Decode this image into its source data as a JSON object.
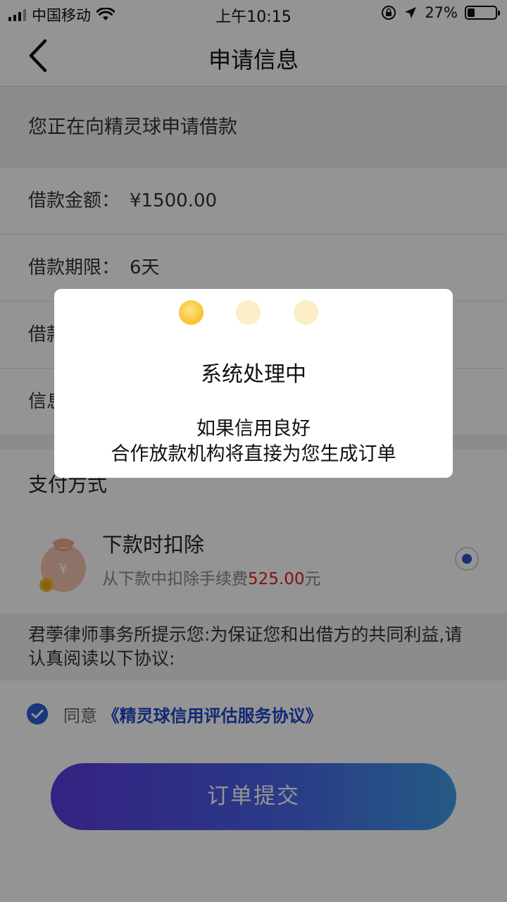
{
  "status_bar": {
    "carrier": "中国移动",
    "time": "上午10:15",
    "battery": "27%",
    "battery_level": 0.27
  },
  "nav": {
    "title": "申请信息",
    "back_icon": "chevron-left-icon"
  },
  "banner": {
    "text": "您正在向精灵球申请借款"
  },
  "rows": [
    {
      "label": "借款金额：",
      "value": "¥1500.00"
    },
    {
      "label": "借款期限：",
      "value": "6天"
    },
    {
      "label": "借款",
      "value": ""
    },
    {
      "label": "信息",
      "value": ""
    }
  ],
  "payment": {
    "section_title": "支付方式",
    "option_name": "下款时扣除",
    "option_desc_prefix": "从下款中扣除手续费",
    "option_fee": "525.00",
    "option_desc_suffix": "元",
    "selected": true
  },
  "notice": {
    "text": "君荸律师事务所提示您:为保证您和出借方的共同利益,请认真阅读以下协议:"
  },
  "agreement": {
    "prefix": "同意",
    "link": "《精灵球信用评估服务协议》",
    "checked": true
  },
  "submit": {
    "label": "订单提交"
  },
  "dialog": {
    "title": "系统处理中",
    "line1": "如果信用良好",
    "line2": "合作放款机构将直接为您生成订单"
  },
  "colors": {
    "accent_blue": "#2a55c8",
    "fee_red": "#e02020",
    "loader_gold": "#f7c12c",
    "loader_pale": "#fbeec6"
  }
}
